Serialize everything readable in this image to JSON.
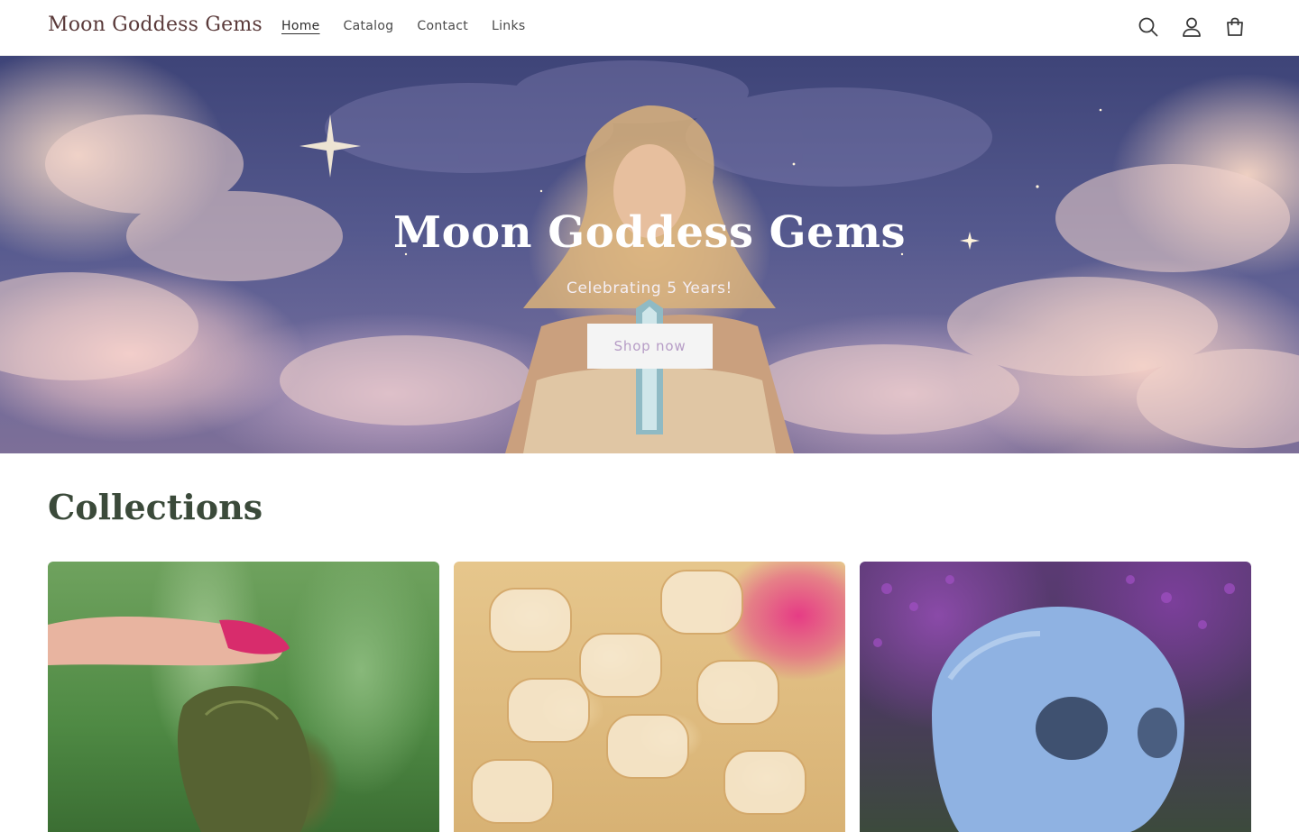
{
  "header": {
    "logo": "Moon Goddess Gems",
    "nav": [
      "Home",
      "Catalog",
      "Contact",
      "Links"
    ],
    "active_nav": "Home",
    "icons": [
      "search-icon",
      "account-icon",
      "cart-icon"
    ]
  },
  "hero": {
    "title": "Moon Goddess Gems",
    "subtitle": "Celebrating 5 Years!",
    "button": "Shop now"
  },
  "collections": {
    "title": "Collections",
    "items": [
      {
        "image": "moldavite-image"
      },
      {
        "image": "citrine-bracelet-image"
      },
      {
        "image": "blue-skull-image"
      }
    ]
  },
  "colors": {
    "brand": "#5a3a3a",
    "button_text": "#b69cc6",
    "heading": "#3b4a3a"
  }
}
